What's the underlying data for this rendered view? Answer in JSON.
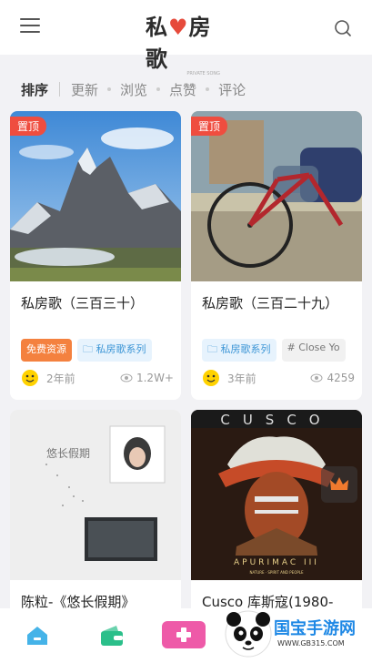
{
  "header": {
    "logo_text_a": "私",
    "logo_text_b": "房歌",
    "logo_sub": "PRIVATE SONG"
  },
  "sort": {
    "title": "排序",
    "options": [
      "更新",
      "浏览",
      "点赞",
      "评论"
    ]
  },
  "cards": [
    {
      "badge": "置顶",
      "title": "私房歌（三百三十）",
      "tags": [
        "免费资源",
        "私房歌系列"
      ],
      "time": "2年前",
      "views": "1.2W+"
    },
    {
      "badge": "置顶",
      "title": "私房歌（三百二十九）",
      "tags": [
        "私房歌系列",
        "# Close Yo"
      ],
      "time": "3年前",
      "views": "4259"
    },
    {
      "title": "陈粒-《悠长假期》",
      "album_text": "悠长假期"
    },
    {
      "title": "Cusco 库斯寇(1980-",
      "album_top": "CUSCO",
      "album_bottom": "APURIMAC III",
      "album_sub": "NATURE · SPIRIT AND PEOPLE"
    }
  ],
  "watermark": {
    "text": "国宝手游网",
    "url": "WWW.GB315.COM"
  },
  "colors": {
    "accent_red": "#ef4d3f",
    "tag_orange": "#f4813f",
    "tag_blue": "#3d96d6",
    "nav_blue": "#45b3e8",
    "nav_green": "#2bbf8a",
    "nav_pink": "#ee5aa8"
  }
}
